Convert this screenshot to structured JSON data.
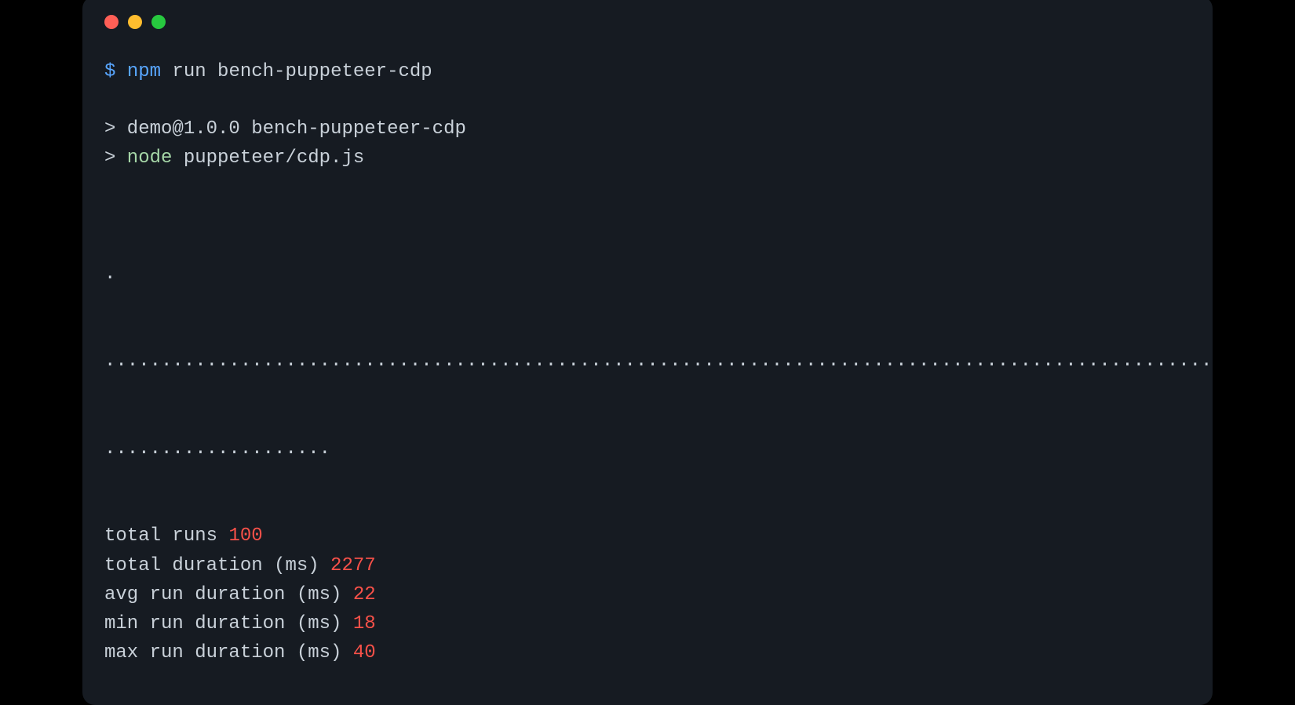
{
  "prompt": {
    "symbol": "$",
    "command_npm": "npm",
    "command_rest": " run bench-puppeteer-cdp"
  },
  "script_header": {
    "line1_arrow": ">",
    "line1_text": " demo@1.0.0 bench-puppeteer-cdp",
    "line2_arrow": ">",
    "line2_node": " node",
    "line2_rest": " puppeteer/cdp.js"
  },
  "dots": {
    "line1": ".",
    "line2": "...................................................................................................",
    "line3": "...................."
  },
  "stats": {
    "total_runs_label": "total runs ",
    "total_runs_value": "100",
    "total_duration_label": "total duration (ms) ",
    "total_duration_value": "2277",
    "avg_label": "avg run duration (ms) ",
    "avg_value": "22",
    "min_label": "min run duration (ms) ",
    "min_value": "18",
    "max_label": "max run duration (ms) ",
    "max_value": "40"
  }
}
